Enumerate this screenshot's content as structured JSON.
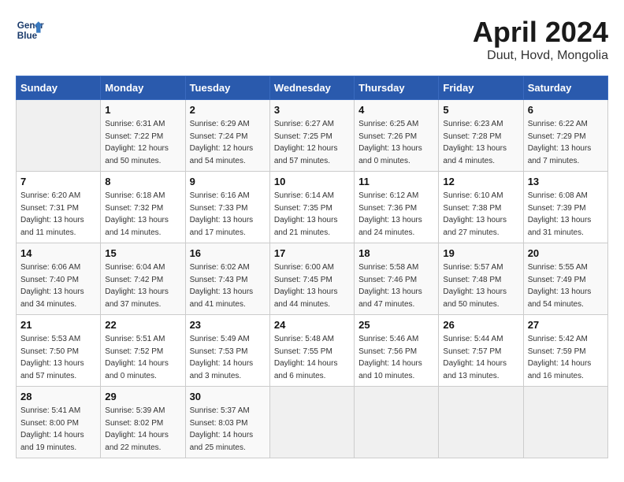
{
  "header": {
    "logo_line1": "General",
    "logo_line2": "Blue",
    "month_year": "April 2024",
    "location": "Duut, Hovd, Mongolia"
  },
  "days_of_week": [
    "Sunday",
    "Monday",
    "Tuesday",
    "Wednesday",
    "Thursday",
    "Friday",
    "Saturday"
  ],
  "weeks": [
    [
      {
        "day": "",
        "sunrise": "",
        "sunset": "",
        "daylight": ""
      },
      {
        "day": "1",
        "sunrise": "Sunrise: 6:31 AM",
        "sunset": "Sunset: 7:22 PM",
        "daylight": "Daylight: 12 hours and 50 minutes."
      },
      {
        "day": "2",
        "sunrise": "Sunrise: 6:29 AM",
        "sunset": "Sunset: 7:24 PM",
        "daylight": "Daylight: 12 hours and 54 minutes."
      },
      {
        "day": "3",
        "sunrise": "Sunrise: 6:27 AM",
        "sunset": "Sunset: 7:25 PM",
        "daylight": "Daylight: 12 hours and 57 minutes."
      },
      {
        "day": "4",
        "sunrise": "Sunrise: 6:25 AM",
        "sunset": "Sunset: 7:26 PM",
        "daylight": "Daylight: 13 hours and 0 minutes."
      },
      {
        "day": "5",
        "sunrise": "Sunrise: 6:23 AM",
        "sunset": "Sunset: 7:28 PM",
        "daylight": "Daylight: 13 hours and 4 minutes."
      },
      {
        "day": "6",
        "sunrise": "Sunrise: 6:22 AM",
        "sunset": "Sunset: 7:29 PM",
        "daylight": "Daylight: 13 hours and 7 minutes."
      }
    ],
    [
      {
        "day": "7",
        "sunrise": "Sunrise: 6:20 AM",
        "sunset": "Sunset: 7:31 PM",
        "daylight": "Daylight: 13 hours and 11 minutes."
      },
      {
        "day": "8",
        "sunrise": "Sunrise: 6:18 AM",
        "sunset": "Sunset: 7:32 PM",
        "daylight": "Daylight: 13 hours and 14 minutes."
      },
      {
        "day": "9",
        "sunrise": "Sunrise: 6:16 AM",
        "sunset": "Sunset: 7:33 PM",
        "daylight": "Daylight: 13 hours and 17 minutes."
      },
      {
        "day": "10",
        "sunrise": "Sunrise: 6:14 AM",
        "sunset": "Sunset: 7:35 PM",
        "daylight": "Daylight: 13 hours and 21 minutes."
      },
      {
        "day": "11",
        "sunrise": "Sunrise: 6:12 AM",
        "sunset": "Sunset: 7:36 PM",
        "daylight": "Daylight: 13 hours and 24 minutes."
      },
      {
        "day": "12",
        "sunrise": "Sunrise: 6:10 AM",
        "sunset": "Sunset: 7:38 PM",
        "daylight": "Daylight: 13 hours and 27 minutes."
      },
      {
        "day": "13",
        "sunrise": "Sunrise: 6:08 AM",
        "sunset": "Sunset: 7:39 PM",
        "daylight": "Daylight: 13 hours and 31 minutes."
      }
    ],
    [
      {
        "day": "14",
        "sunrise": "Sunrise: 6:06 AM",
        "sunset": "Sunset: 7:40 PM",
        "daylight": "Daylight: 13 hours and 34 minutes."
      },
      {
        "day": "15",
        "sunrise": "Sunrise: 6:04 AM",
        "sunset": "Sunset: 7:42 PM",
        "daylight": "Daylight: 13 hours and 37 minutes."
      },
      {
        "day": "16",
        "sunrise": "Sunrise: 6:02 AM",
        "sunset": "Sunset: 7:43 PM",
        "daylight": "Daylight: 13 hours and 41 minutes."
      },
      {
        "day": "17",
        "sunrise": "Sunrise: 6:00 AM",
        "sunset": "Sunset: 7:45 PM",
        "daylight": "Daylight: 13 hours and 44 minutes."
      },
      {
        "day": "18",
        "sunrise": "Sunrise: 5:58 AM",
        "sunset": "Sunset: 7:46 PM",
        "daylight": "Daylight: 13 hours and 47 minutes."
      },
      {
        "day": "19",
        "sunrise": "Sunrise: 5:57 AM",
        "sunset": "Sunset: 7:48 PM",
        "daylight": "Daylight: 13 hours and 50 minutes."
      },
      {
        "day": "20",
        "sunrise": "Sunrise: 5:55 AM",
        "sunset": "Sunset: 7:49 PM",
        "daylight": "Daylight: 13 hours and 54 minutes."
      }
    ],
    [
      {
        "day": "21",
        "sunrise": "Sunrise: 5:53 AM",
        "sunset": "Sunset: 7:50 PM",
        "daylight": "Daylight: 13 hours and 57 minutes."
      },
      {
        "day": "22",
        "sunrise": "Sunrise: 5:51 AM",
        "sunset": "Sunset: 7:52 PM",
        "daylight": "Daylight: 14 hours and 0 minutes."
      },
      {
        "day": "23",
        "sunrise": "Sunrise: 5:49 AM",
        "sunset": "Sunset: 7:53 PM",
        "daylight": "Daylight: 14 hours and 3 minutes."
      },
      {
        "day": "24",
        "sunrise": "Sunrise: 5:48 AM",
        "sunset": "Sunset: 7:55 PM",
        "daylight": "Daylight: 14 hours and 6 minutes."
      },
      {
        "day": "25",
        "sunrise": "Sunrise: 5:46 AM",
        "sunset": "Sunset: 7:56 PM",
        "daylight": "Daylight: 14 hours and 10 minutes."
      },
      {
        "day": "26",
        "sunrise": "Sunrise: 5:44 AM",
        "sunset": "Sunset: 7:57 PM",
        "daylight": "Daylight: 14 hours and 13 minutes."
      },
      {
        "day": "27",
        "sunrise": "Sunrise: 5:42 AM",
        "sunset": "Sunset: 7:59 PM",
        "daylight": "Daylight: 14 hours and 16 minutes."
      }
    ],
    [
      {
        "day": "28",
        "sunrise": "Sunrise: 5:41 AM",
        "sunset": "Sunset: 8:00 PM",
        "daylight": "Daylight: 14 hours and 19 minutes."
      },
      {
        "day": "29",
        "sunrise": "Sunrise: 5:39 AM",
        "sunset": "Sunset: 8:02 PM",
        "daylight": "Daylight: 14 hours and 22 minutes."
      },
      {
        "day": "30",
        "sunrise": "Sunrise: 5:37 AM",
        "sunset": "Sunset: 8:03 PM",
        "daylight": "Daylight: 14 hours and 25 minutes."
      },
      {
        "day": "",
        "sunrise": "",
        "sunset": "",
        "daylight": ""
      },
      {
        "day": "",
        "sunrise": "",
        "sunset": "",
        "daylight": ""
      },
      {
        "day": "",
        "sunrise": "",
        "sunset": "",
        "daylight": ""
      },
      {
        "day": "",
        "sunrise": "",
        "sunset": "",
        "daylight": ""
      }
    ]
  ]
}
